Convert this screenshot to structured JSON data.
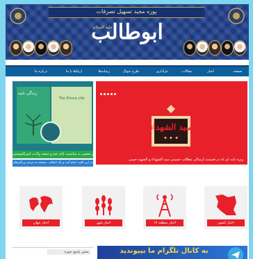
{
  "banner": {
    "subtitle": "پوزه مجید تسهیل تصرفات",
    "title": "ابوطالب",
    "title_small": "علیه السلام"
  },
  "nav": {
    "items": [
      "صفحه",
      "اخبار",
      "مقالات",
      "عزاداری",
      "طرح سوال",
      "رسانه‌ها",
      "ارتباط با ما",
      "درباره ما"
    ]
  },
  "slider": {
    "logo_text": "سید الشهداء",
    "caption": "ویژه نامه ای که در قسمت ارسالی مطالب حسینی سید الشهداء و الشهید حبیبی"
  },
  "left_tile": {
    "cover_title": "زندگی نامه",
    "cover_title2": "The Prince Life",
    "green_bar": "مسابقه دو بخشی به مناسبت ایام عید و جمعه ولادت امیرالمومنین",
    "blue_bar": "در این کلیپ امام آیت و یک اسلام ، مسجد به مردم بزرگترهای"
  },
  "categories": [
    {
      "label": "اخبار جهان",
      "icon": "world-map-icon"
    },
    {
      "label": "اخبار شهر",
      "icon": "wheat-icon"
    },
    {
      "label": "اخبار منطقه ۱۷",
      "icon": "radio-tower-icon"
    },
    {
      "label": "اخبار کشور",
      "icon": "iran-map-icon"
    }
  ],
  "sidebar": {
    "header": "بخش پاسخ حوزه"
  },
  "telegram": {
    "text": "به کانال تلگرام ما بپیوندید"
  },
  "colors": {
    "accent": "#e8202a",
    "nav": "#0e5f9e",
    "banner": "#1f3f8a",
    "page_bg": "#7fd6ee"
  }
}
